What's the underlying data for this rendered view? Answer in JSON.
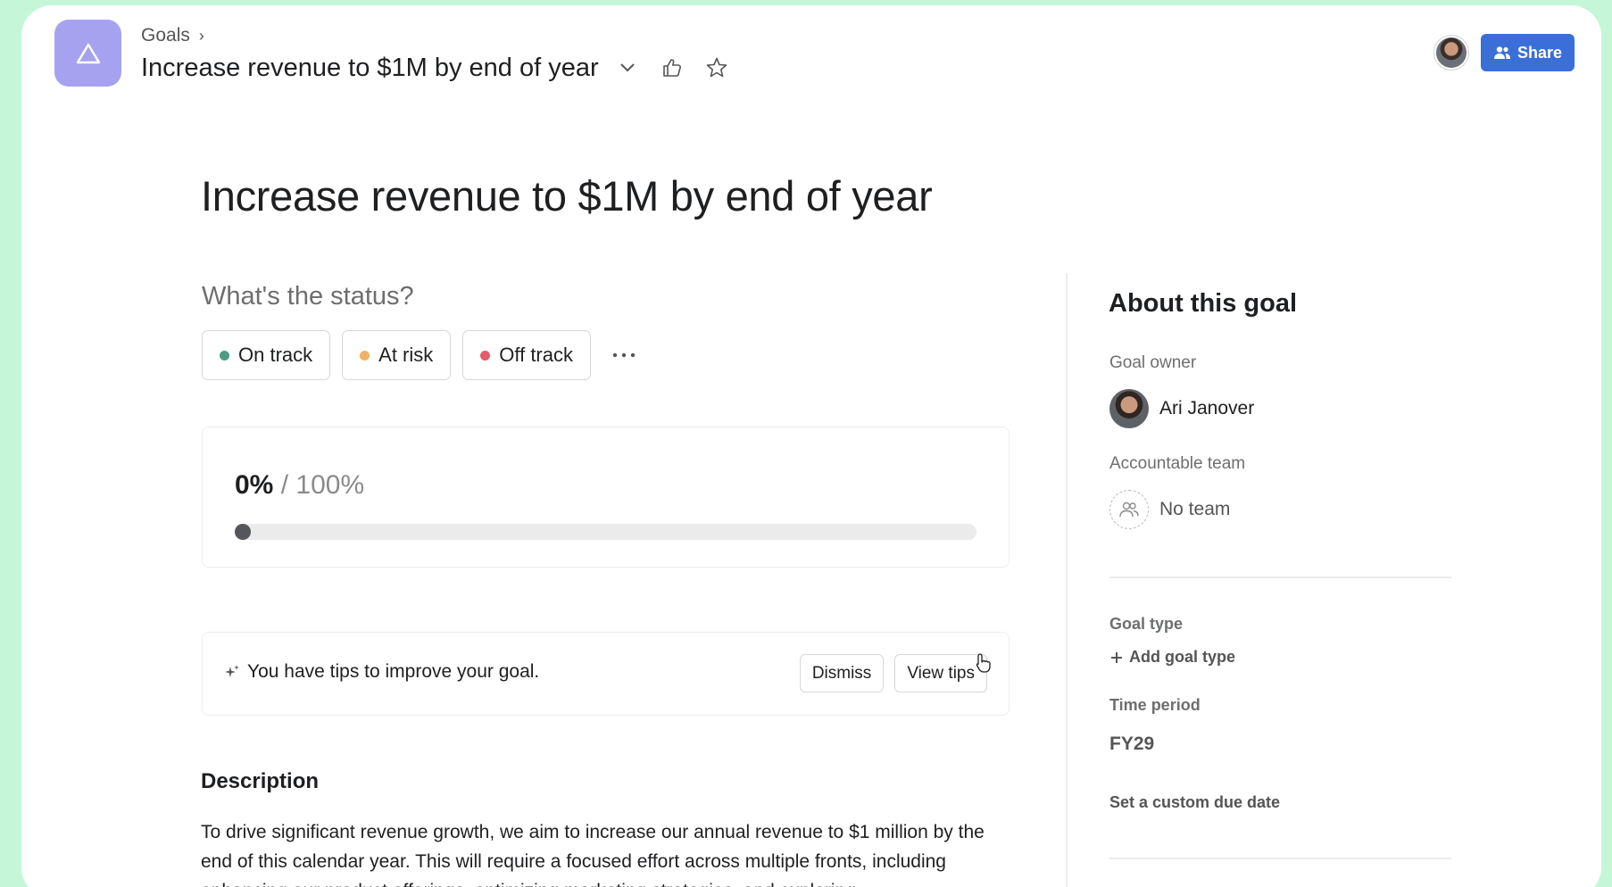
{
  "header": {
    "breadcrumb": "Goals",
    "title": "Increase revenue to $1M by end of year",
    "share_label": "Share"
  },
  "page": {
    "title": "Increase revenue to $1M by end of year"
  },
  "status": {
    "question": "What's the status?",
    "options": [
      {
        "label": "On track",
        "color": "#4e9a82"
      },
      {
        "label": "At risk",
        "color": "#f0b266"
      },
      {
        "label": "Off track",
        "color": "#e35c6a"
      }
    ]
  },
  "progress": {
    "current": "0%",
    "separator": "/",
    "total": "100%",
    "fraction": 0
  },
  "tips": {
    "text": "You have tips to improve your goal.",
    "dismiss_label": "Dismiss",
    "view_label": "View tips"
  },
  "description": {
    "title": "Description",
    "body": "To drive significant revenue growth, we aim to increase our annual revenue to $1 million by the end of this calendar year. This will require a focused effort across multiple fronts, including enhancing our product offerings, optimizing marketing strategies, and exploring"
  },
  "about": {
    "title": "About this goal",
    "owner_label": "Goal owner",
    "owner_name": "Ari Janover",
    "team_label": "Accountable team",
    "team_value": "No team",
    "type_label": "Goal type",
    "add_type_label": "Add goal type",
    "period_label": "Time period",
    "period_value": "FY29",
    "due_date_label": "Set a custom due date"
  },
  "colors": {
    "app_icon": "#a6a2f0",
    "share_button": "#3b6fd8",
    "background": "#c6f6d8"
  }
}
